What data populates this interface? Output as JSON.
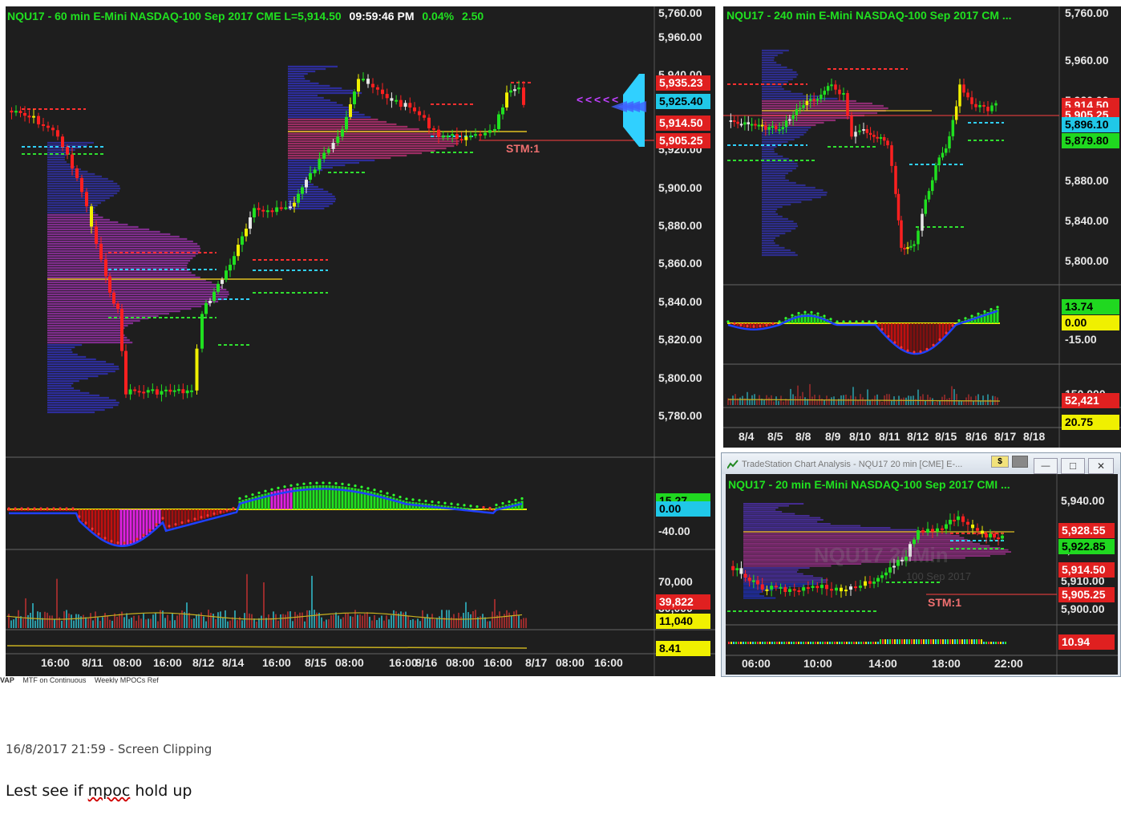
{
  "main_chart": {
    "title": "NQU17 - 60 min  E-Mini NASDAQ-100 Sep 2017  CME  L=5,914.50",
    "time": "09:59:46 PM",
    "change_pct": "0.04%",
    "change_pts": "2.50",
    "price_ticks": [
      "5,960.00",
      "5,940.00",
      "5,920.00",
      "5,900.00",
      "5,880.00",
      "5,860.00",
      "5,840.00",
      "5,820.00",
      "5,800.00",
      "5,780.00",
      "5,760.00"
    ],
    "price_boxes": [
      {
        "label": "5,935.23",
        "color": "#e02020",
        "text": "#ffffff"
      },
      {
        "label": "5,925.40",
        "color": "#20c8e8",
        "text": "#000000"
      },
      {
        "label": "5,914.50",
        "color": "#e02020",
        "text": "#ffffff"
      },
      {
        "label": "5,905.25",
        "color": "#e02020",
        "text": "#ffffff"
      }
    ],
    "stm_label": "STM:1",
    "indicator_ticks": [
      "-40.00"
    ],
    "indicator_boxes": [
      {
        "label": "15.27",
        "color": "#20d820",
        "text": "#000000"
      },
      {
        "label": "0.00",
        "color": "#20c8e8",
        "text": "#000000"
      }
    ],
    "volume_ticks": [
      "70,000",
      "30,000"
    ],
    "volume_boxes": [
      {
        "label": "39,822",
        "color": "#e02020",
        "text": "#ffffff"
      },
      {
        "label": "11,040",
        "color": "#f0f000",
        "text": "#000000"
      }
    ],
    "bottom_box": {
      "label": "8.41",
      "color": "#f0f000",
      "text": "#000000"
    },
    "time_axis": [
      "16:00",
      "8/11",
      "08:00",
      "16:00",
      "8/12",
      "8/14",
      "16:00",
      "8/15",
      "08:00",
      "16:00",
      "8/16",
      "08:00",
      "16:00",
      "8/17",
      "08:00",
      "16:00"
    ]
  },
  "chart_240": {
    "title": "NQU17 - 240 min  E-Mini NASDAQ-100 Sep 2017  CM ...",
    "price_ticks": [
      "5,960.00",
      "5,920.00",
      "5,880.00",
      "5,840.00",
      "5,800.00",
      "5,760.00"
    ],
    "price_boxes": [
      {
        "label": "5,914.50",
        "color": "#e02020",
        "text": "#ffffff"
      },
      {
        "label": "5,905.25",
        "color": "#e02020",
        "text": "#ffffff"
      },
      {
        "label": "5,896.10",
        "color": "#20c8e8",
        "text": "#000000"
      },
      {
        "label": "5,879.80",
        "color": "#20d820",
        "text": "#000000"
      }
    ],
    "indicator_ticks": [
      "-15.00"
    ],
    "indicator_boxes": [
      {
        "label": "13.74",
        "color": "#20d820",
        "text": "#000000"
      },
      {
        "label": "0.00",
        "color": "#f0f000",
        "text": "#000000"
      }
    ],
    "volume_ticks": [
      "150,000"
    ],
    "volume_boxes": [
      {
        "label": "52,421",
        "color": "#e02020",
        "text": "#ffffff"
      },
      {
        "label": "20.75",
        "color": "#f0f000",
        "text": "#000000"
      }
    ],
    "time_axis": [
      "8/4",
      "8/5",
      "8/8",
      "8/9",
      "8/10",
      "8/11",
      "8/12",
      "8/15",
      "8/16",
      "8/17",
      "8/18"
    ]
  },
  "window_20": {
    "window_title": "TradeStation Chart Analysis - NQU17 20 min [CME] E-...",
    "title": "NQU17 - 20 min  E-Mini NASDAQ-100 Sep 2017  CMI ...",
    "watermark_symbol": "NQU17 20Min",
    "watermark_contract": "100 Sep 2017",
    "price_ticks": [
      "5,940.00",
      "5,920.00",
      "5,910.00",
      "5,900.00"
    ],
    "price_boxes": [
      {
        "label": "5,928.55",
        "color": "#e02020",
        "text": "#ffffff"
      },
      {
        "label": "5,922.85",
        "color": "#20d820",
        "text": "#000000"
      },
      {
        "label": "5,914.50",
        "color": "#e02020",
        "text": "#ffffff"
      },
      {
        "label": "5,905.25",
        "color": "#e02020",
        "text": "#ffffff"
      }
    ],
    "stm_label": "STM:1",
    "bottom_box": {
      "label": "10.94",
      "color": "#e02020",
      "text": "#ffffff"
    },
    "time_axis": [
      "06:00",
      "10:00",
      "14:00",
      "18:00",
      "22:00"
    ],
    "buttons": {
      "dollar": "$",
      "minimize": "—",
      "restore": "□",
      "close": "✕"
    }
  },
  "tabs": [
    "VAP",
    "MTF on Continuous",
    "Weekly MPOCs Ref"
  ],
  "caption": {
    "clip_info": "16/8/2017 21:59 - Screen Clipping",
    "note_prefix": "Lest see if ",
    "note_word": "mpoc",
    "note_suffix": " hold up"
  }
}
